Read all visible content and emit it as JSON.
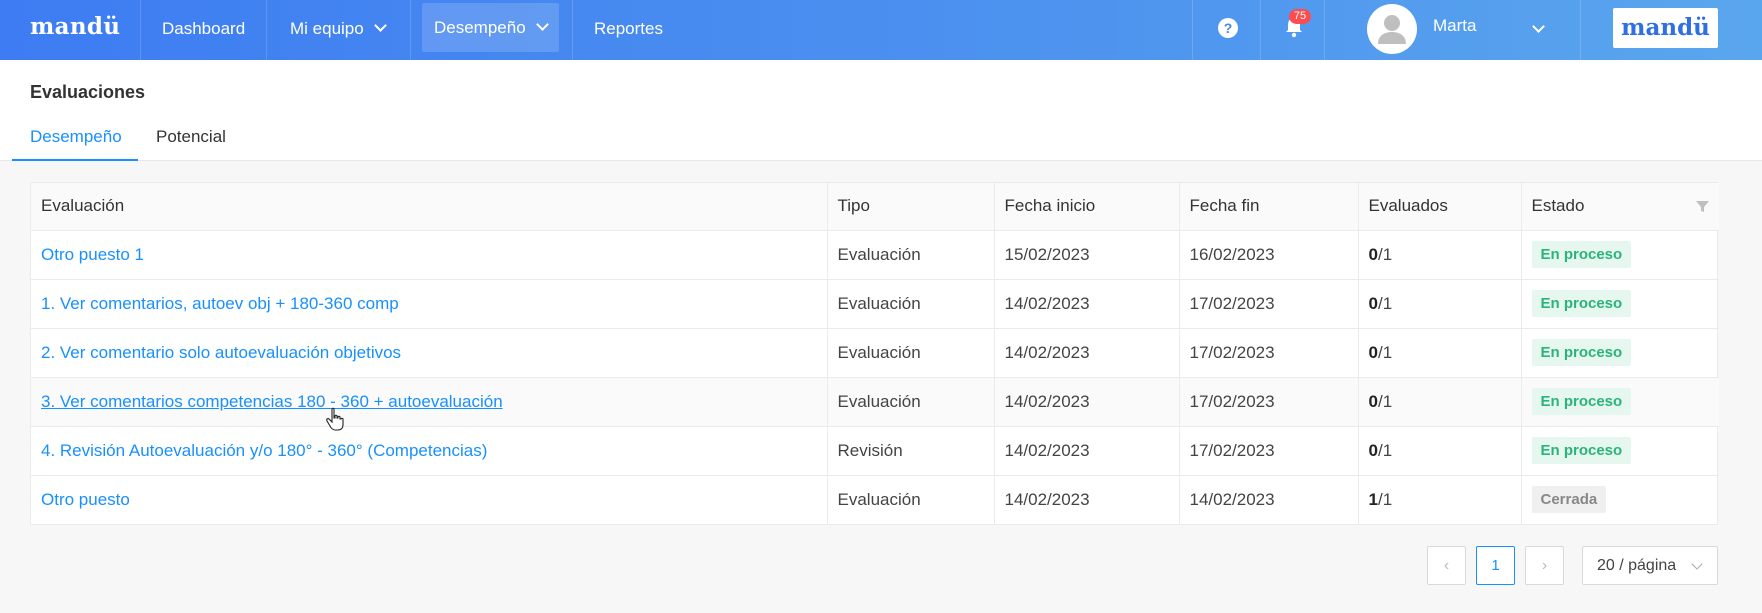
{
  "topbar": {
    "logo": "mandü",
    "nav": [
      {
        "label": "Dashboard",
        "dropdown": false
      },
      {
        "label": "Mi equipo",
        "dropdown": true
      },
      {
        "label": "Desempeño",
        "dropdown": true,
        "active": true
      },
      {
        "label": "Reportes",
        "dropdown": false
      }
    ],
    "help_icon": "question-circle-icon",
    "notifications_count": "75",
    "user_name": "Marta",
    "brand_logo": "mandü"
  },
  "page": {
    "title": "Evaluaciones",
    "tabs": [
      {
        "label": "Desempeño",
        "active": true
      },
      {
        "label": "Potencial",
        "active": false
      }
    ]
  },
  "table": {
    "columns": [
      "Evaluación",
      "Tipo",
      "Fecha inicio",
      "Fecha fin",
      "Evaluados",
      "Estado"
    ],
    "rows": [
      {
        "evaluacion": "Otro puesto 1",
        "tipo": "Evaluación",
        "inicio": "15/02/2023",
        "fin": "16/02/2023",
        "evaluados_done": "0",
        "evaluados_total": "/1",
        "estado": "En proceso"
      },
      {
        "evaluacion": "1. Ver comentarios, autoev obj + 180-360 comp",
        "tipo": "Evaluación",
        "inicio": "14/02/2023",
        "fin": "17/02/2023",
        "evaluados_done": "0",
        "evaluados_total": "/1",
        "estado": "En proceso"
      },
      {
        "evaluacion": "2. Ver comentario solo autoevaluación objetivos",
        "tipo": "Evaluación",
        "inicio": "14/02/2023",
        "fin": "17/02/2023",
        "evaluados_done": "0",
        "evaluados_total": "/1",
        "estado": "En proceso"
      },
      {
        "evaluacion": "3. Ver comentarios competencias 180 - 360 + autoevaluación",
        "tipo": "Evaluación",
        "inicio": "14/02/2023",
        "fin": "17/02/2023",
        "evaluados_done": "0",
        "evaluados_total": "/1",
        "estado": "En proceso"
      },
      {
        "evaluacion": "4. Revisión Autoevaluación y/o 180° - 360° (Competencias)",
        "tipo": "Revisión",
        "inicio": "14/02/2023",
        "fin": "17/02/2023",
        "evaluados_done": "0",
        "evaluados_total": "/1",
        "estado": "En proceso"
      },
      {
        "evaluacion": "Otro puesto",
        "tipo": "Evaluación",
        "inicio": "14/02/2023",
        "fin": "14/02/2023",
        "evaluados_done": "1",
        "evaluados_total": "/1",
        "estado": "Cerrada"
      }
    ]
  },
  "pagination": {
    "current_page": "1",
    "page_size_label": "20 / página"
  },
  "colors": {
    "accent": "#1890ff",
    "in_progress_bg": "#e6f7f0",
    "in_progress_text": "#2bb47a",
    "closed_bg": "#f0f0f0",
    "closed_text": "#888888"
  }
}
